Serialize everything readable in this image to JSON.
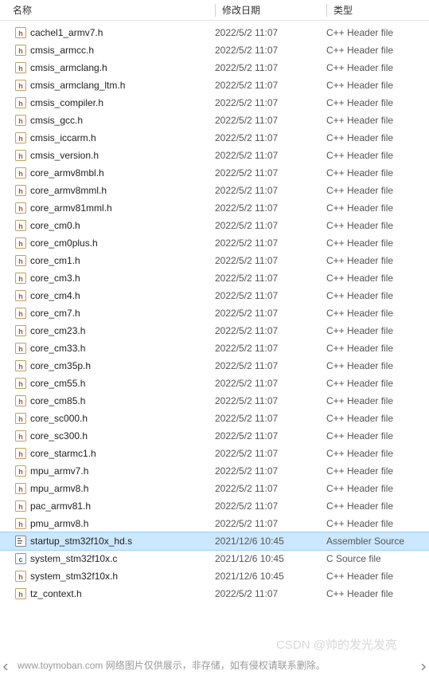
{
  "columns": {
    "name": "名称",
    "date": "修改日期",
    "type": "类型"
  },
  "iconTypes": {
    "h": "header",
    "c": "c-source",
    "s": "asm"
  },
  "files": [
    {
      "name": "cachel1_armv7.h",
      "date": "2022/5/2 11:07",
      "type": "C++ Header file",
      "icon": "h",
      "selected": false
    },
    {
      "name": "cmsis_armcc.h",
      "date": "2022/5/2 11:07",
      "type": "C++ Header file",
      "icon": "h",
      "selected": false
    },
    {
      "name": "cmsis_armclang.h",
      "date": "2022/5/2 11:07",
      "type": "C++ Header file",
      "icon": "h",
      "selected": false
    },
    {
      "name": "cmsis_armclang_ltm.h",
      "date": "2022/5/2 11:07",
      "type": "C++ Header file",
      "icon": "h",
      "selected": false
    },
    {
      "name": "cmsis_compiler.h",
      "date": "2022/5/2 11:07",
      "type": "C++ Header file",
      "icon": "h",
      "selected": false
    },
    {
      "name": "cmsis_gcc.h",
      "date": "2022/5/2 11:07",
      "type": "C++ Header file",
      "icon": "h",
      "selected": false
    },
    {
      "name": "cmsis_iccarm.h",
      "date": "2022/5/2 11:07",
      "type": "C++ Header file",
      "icon": "h",
      "selected": false
    },
    {
      "name": "cmsis_version.h",
      "date": "2022/5/2 11:07",
      "type": "C++ Header file",
      "icon": "h",
      "selected": false
    },
    {
      "name": "core_armv8mbl.h",
      "date": "2022/5/2 11:07",
      "type": "C++ Header file",
      "icon": "h",
      "selected": false
    },
    {
      "name": "core_armv8mml.h",
      "date": "2022/5/2 11:07",
      "type": "C++ Header file",
      "icon": "h",
      "selected": false
    },
    {
      "name": "core_armv81mml.h",
      "date": "2022/5/2 11:07",
      "type": "C++ Header file",
      "icon": "h",
      "selected": false
    },
    {
      "name": "core_cm0.h",
      "date": "2022/5/2 11:07",
      "type": "C++ Header file",
      "icon": "h",
      "selected": false
    },
    {
      "name": "core_cm0plus.h",
      "date": "2022/5/2 11:07",
      "type": "C++ Header file",
      "icon": "h",
      "selected": false
    },
    {
      "name": "core_cm1.h",
      "date": "2022/5/2 11:07",
      "type": "C++ Header file",
      "icon": "h",
      "selected": false
    },
    {
      "name": "core_cm3.h",
      "date": "2022/5/2 11:07",
      "type": "C++ Header file",
      "icon": "h",
      "selected": false
    },
    {
      "name": "core_cm4.h",
      "date": "2022/5/2 11:07",
      "type": "C++ Header file",
      "icon": "h",
      "selected": false
    },
    {
      "name": "core_cm7.h",
      "date": "2022/5/2 11:07",
      "type": "C++ Header file",
      "icon": "h",
      "selected": false
    },
    {
      "name": "core_cm23.h",
      "date": "2022/5/2 11:07",
      "type": "C++ Header file",
      "icon": "h",
      "selected": false
    },
    {
      "name": "core_cm33.h",
      "date": "2022/5/2 11:07",
      "type": "C++ Header file",
      "icon": "h",
      "selected": false
    },
    {
      "name": "core_cm35p.h",
      "date": "2022/5/2 11:07",
      "type": "C++ Header file",
      "icon": "h",
      "selected": false
    },
    {
      "name": "core_cm55.h",
      "date": "2022/5/2 11:07",
      "type": "C++ Header file",
      "icon": "h",
      "selected": false
    },
    {
      "name": "core_cm85.h",
      "date": "2022/5/2 11:07",
      "type": "C++ Header file",
      "icon": "h",
      "selected": false
    },
    {
      "name": "core_sc000.h",
      "date": "2022/5/2 11:07",
      "type": "C++ Header file",
      "icon": "h",
      "selected": false
    },
    {
      "name": "core_sc300.h",
      "date": "2022/5/2 11:07",
      "type": "C++ Header file",
      "icon": "h",
      "selected": false
    },
    {
      "name": "core_starmc1.h",
      "date": "2022/5/2 11:07",
      "type": "C++ Header file",
      "icon": "h",
      "selected": false
    },
    {
      "name": "mpu_armv7.h",
      "date": "2022/5/2 11:07",
      "type": "C++ Header file",
      "icon": "h",
      "selected": false
    },
    {
      "name": "mpu_armv8.h",
      "date": "2022/5/2 11:07",
      "type": "C++ Header file",
      "icon": "h",
      "selected": false
    },
    {
      "name": "pac_armv81.h",
      "date": "2022/5/2 11:07",
      "type": "C++ Header file",
      "icon": "h",
      "selected": false
    },
    {
      "name": "pmu_armv8.h",
      "date": "2022/5/2 11:07",
      "type": "C++ Header file",
      "icon": "h",
      "selected": false
    },
    {
      "name": "startup_stm32f10x_hd.s",
      "date": "2021/12/6 10:45",
      "type": "Assembler Source",
      "icon": "s",
      "selected": true
    },
    {
      "name": "system_stm32f10x.c",
      "date": "2021/12/6 10:45",
      "type": "C Source file",
      "icon": "c",
      "selected": false
    },
    {
      "name": "system_stm32f10x.h",
      "date": "2021/12/6 10:45",
      "type": "C++ Header file",
      "icon": "h",
      "selected": false
    },
    {
      "name": "tz_context.h",
      "date": "2022/5/2 11:07",
      "type": "C++ Header file",
      "icon": "h",
      "selected": false
    }
  ],
  "watermark": "CSDN @帅的发光发亮",
  "footer": "www.toymoban.com 网络图片仅供展示，非存储，如有侵权请联系删除。"
}
